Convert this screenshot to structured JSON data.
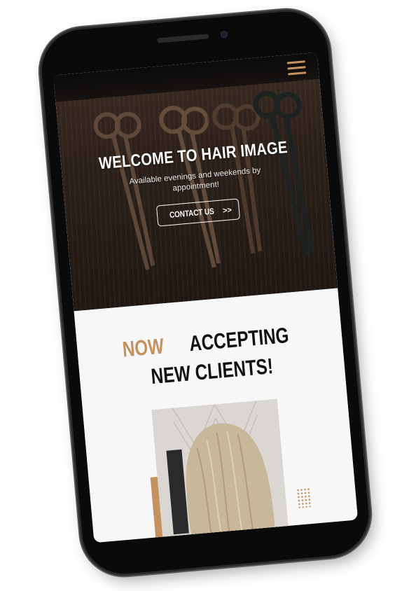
{
  "header": {
    "menu_icon": "hamburger-menu-icon"
  },
  "hero": {
    "title": "WELCOME TO HAIR IMAGE",
    "subtitle": "Available evenings and weekends by appointment!",
    "cta_label": "CONTACT US",
    "cta_arrows": ">>"
  },
  "section": {
    "headline_accent": "NOW",
    "headline_rest_1": "ACCEPTING",
    "headline_line_2": "NEW CLIENTS!",
    "photo_icon": "blonde-hair-photo"
  },
  "colors": {
    "accent": "#c5915e",
    "hero_dark": "#2b2019",
    "phone_body": "#0a0a0a",
    "section_bg": "#f7f7f7"
  }
}
